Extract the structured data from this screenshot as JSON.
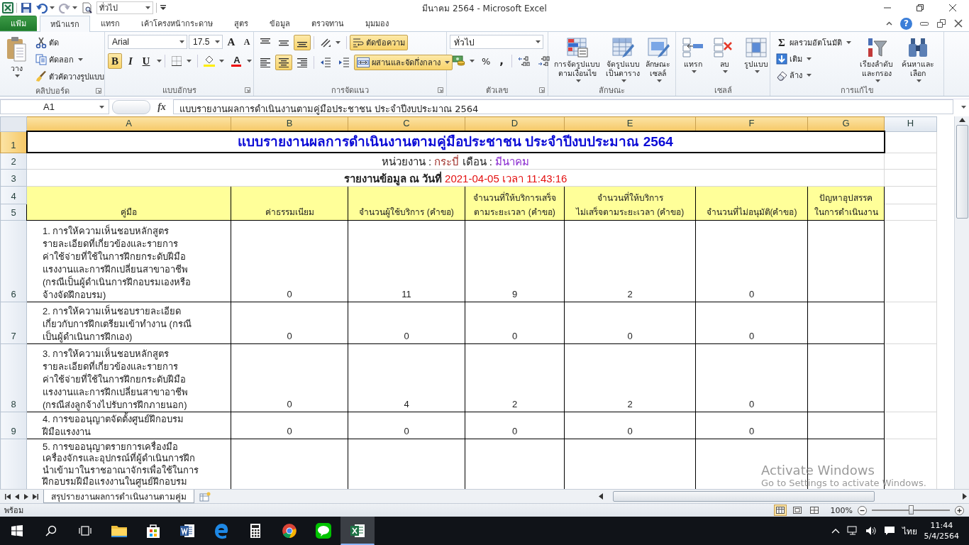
{
  "window": {
    "title": "มีนาคม 2564 - Microsoft Excel",
    "help": "?"
  },
  "quick_access": {
    "style_box": "ทั่วไป"
  },
  "tabs": [
    {
      "label": "แฟ้ม",
      "kind": "file",
      "selected": false
    },
    {
      "label": "หน้าแรก",
      "kind": "tab",
      "selected": true
    },
    {
      "label": "แทรก",
      "kind": "tab",
      "selected": false
    },
    {
      "label": "เค้าโครงหน้ากระดาษ",
      "kind": "tab",
      "selected": false
    },
    {
      "label": "สูตร",
      "kind": "tab",
      "selected": false
    },
    {
      "label": "ข้อมูล",
      "kind": "tab",
      "selected": false
    },
    {
      "label": "ตรวจทาน",
      "kind": "tab",
      "selected": false
    },
    {
      "label": "มุมมอง",
      "kind": "tab",
      "selected": false
    }
  ],
  "ribbon": {
    "clipboard": {
      "label": "คลิปบอร์ด",
      "paste": "วาง",
      "cut": "ตัด",
      "copy": "คัดลอก",
      "format_painter": "ตัวคัดวางรูปแบบ"
    },
    "font": {
      "label": "แบบอักษร",
      "name": "Arial",
      "size": "17.5",
      "grow": "A",
      "shrink": "A",
      "font_color": "A",
      "styles": [
        {
          "kind": "bold",
          "label": "B",
          "selected": true
        },
        {
          "kind": "italic",
          "label": "I",
          "selected": false
        },
        {
          "kind": "underline",
          "label": "U",
          "selected": false
        }
      ]
    },
    "alignment": {
      "label": "การจัดแนว",
      "vertical": [
        {
          "kind": "top",
          "selected": false
        },
        {
          "kind": "middle",
          "selected": false
        },
        {
          "kind": "bottom",
          "selected": true
        }
      ],
      "horizontal": [
        {
          "kind": "left",
          "selected": false
        },
        {
          "kind": "center",
          "selected": true
        },
        {
          "kind": "right",
          "selected": false
        }
      ],
      "wrap": {
        "label": "ตัดข้อความ",
        "selected": true
      },
      "merge": {
        "label": "ผสานและจัดกึ่งกลาง",
        "selected": true
      }
    },
    "number": {
      "label": "ตัวเลข",
      "format": "ทั่วไป",
      "percent": "%",
      "comma": ","
    },
    "styles": {
      "label": "ลักษณะ",
      "buttons": [
        {
          "kind": "conditional",
          "label": "การจัดรูปแบบ\nตามเงื่อนไข"
        },
        {
          "kind": "table",
          "label": "จัดรูปแบบ\nเป็นตาราง"
        },
        {
          "kind": "cell",
          "label": "ลักษณะ\nเซลล์"
        }
      ]
    },
    "cells": {
      "label": "เซลล์",
      "buttons": [
        {
          "kind": "insert",
          "label": "แทรก"
        },
        {
          "kind": "delete",
          "label": "ลบ"
        },
        {
          "kind": "format",
          "label": "รูปแบบ"
        }
      ]
    },
    "editing": {
      "label": "การแก้ไข",
      "sigma": "Σ",
      "autosum": "ผลรวมอัตโนมัติ",
      "fill": "เติม",
      "clear": "ล้าง",
      "buttons": [
        {
          "kind": "sort",
          "label": "เรียงลำดับ\nและกรอง"
        },
        {
          "kind": "find",
          "label": "ค้นหาและ\nเลือก"
        }
      ]
    }
  },
  "formula_bar": {
    "name_box": "A1",
    "fx": "fx",
    "content": "แบบรายงานผลการดำเนินงานตามคู่มือประชาชน ประจำปีงบประมาณ 2564"
  },
  "sheet": {
    "columns": [
      {
        "label": "A",
        "selected": true
      },
      {
        "label": "B",
        "selected": true
      },
      {
        "label": "C",
        "selected": true
      },
      {
        "label": "D",
        "selected": true
      },
      {
        "label": "E",
        "selected": true
      },
      {
        "label": "F",
        "selected": true
      },
      {
        "label": "G",
        "selected": true
      },
      {
        "label": "H",
        "selected": false
      }
    ],
    "title_row": {
      "row": "1",
      "selected": true,
      "text": "แบบรายงานผลการดำเนินงานตามคู่มือประชาชน ประจำปีงบประมาณ 2564"
    },
    "agency_row": {
      "row": "2",
      "agency_label": "หน่วยงาน :",
      "agency": "กระบี่",
      "month_label": "เดือน :",
      "month": "มีนาคม"
    },
    "date_row": {
      "row": "3",
      "label": "รายงานข้อมูล ณ วันที่",
      "timestamp": "2021-04-05 เวลา 11:43:16"
    },
    "header_rows": [
      "4",
      "5"
    ],
    "headers": [
      "คู่มือ",
      "ค่าธรรมเนียม",
      "จำนวนผู้ใช้บริการ (คำขอ)",
      "จำนวนที่ให้บริการเสร็จ\nตามระยะเวลา (คำขอ)",
      "จำนวนที่ให้บริการ\nไม่เสร็จตามระยะเวลา (คำขอ)",
      "จำนวนที่ไม่อนุมัติ(คำขอ)",
      "ปัญหาอุปสรรค\nในการดำเนินงาน"
    ],
    "rows": [
      {
        "row": "6",
        "manual": "1. การให้ความเห็นชอบหลักสูตร\nรายละเอียดที่เกี่ยวข้องและรายการ\nค่าใช้จ่ายที่ใช้ในการฝึกยกระดับฝีมือ\nแรงงานและการฝึกเปลี่ยนสาขาอาชีพ\n(กรณีเป็นผู้ดำเนินการฝึกอบรมเองหรือ\nจ้างจัดฝึกอบรม)",
        "values": [
          "0",
          "11",
          "9",
          "2",
          "0"
        ]
      },
      {
        "row": "7",
        "manual": "2. การให้ความเห็นชอบรายละเอียด\nเกี่ยวกับการฝึกเตรียมเข้าทำงาน (กรณี\nเป็นผู้ดำเนินการฝึกเอง)",
        "values": [
          "0",
          "0",
          "0",
          "0",
          "0"
        ]
      },
      {
        "row": "8",
        "manual": "3. การให้ความเห็นชอบหลักสูตร\nรายละเอียดที่เกี่ยวข้องและรายการ\nค่าใช้จ่ายที่ใช้ในการฝึกยกระดับฝีมือ\nแรงงานและการฝึกเปลี่ยนสาขาอาชีพ\n(กรณีส่งลูกจ้างไปรับการฝึกภายนอก)",
        "values": [
          "0",
          "4",
          "2",
          "2",
          "0"
        ]
      },
      {
        "row": "9",
        "manual": "4. การขออนุญาตจัดตั้งศูนย์ฝึกอบรม\nฝีมือแรงงาน",
        "values": [
          "0",
          "0",
          "0",
          "0",
          "0"
        ]
      },
      {
        "manual": "5. การขออนุญาตรายการเครื่องมือ\nเครื่องจักรและอุปกรณ์ที่ผู้ดำเนินการฝึก\nนำเข้ามาในราชอาณาจักรเพื่อใช้ในการ\nฝึกอบรมฝีมือแรงงานในศูนย์ฝึกอบรม"
      }
    ]
  },
  "sheet_tabs": [
    {
      "label": "สรุปรายงานผลการดำเนินงานตามคู่ม",
      "selected": true
    }
  ],
  "status_bar": {
    "text": "พร้อม",
    "views": [
      {
        "kind": "normal",
        "selected": true
      },
      {
        "kind": "layout",
        "selected": false
      },
      {
        "kind": "break",
        "selected": false
      }
    ],
    "zoom": "100%",
    "zoom_slider": {
      "level": 0.5
    }
  },
  "taskbar": {
    "apps": [
      {
        "kind": "explorer",
        "selected": false
      },
      {
        "kind": "store",
        "selected": false
      },
      {
        "kind": "word",
        "selected": false
      },
      {
        "kind": "edge",
        "selected": false
      },
      {
        "kind": "calculator",
        "selected": false
      },
      {
        "kind": "chrome",
        "selected": false
      },
      {
        "kind": "line",
        "selected": false
      },
      {
        "kind": "excel",
        "selected": true
      }
    ],
    "language": "ไทย",
    "time": "11:44",
    "date": "5/4/2564"
  },
  "os_notice": {
    "title": "Activate Windows",
    "text": "Go to Settings to activate Windows."
  }
}
